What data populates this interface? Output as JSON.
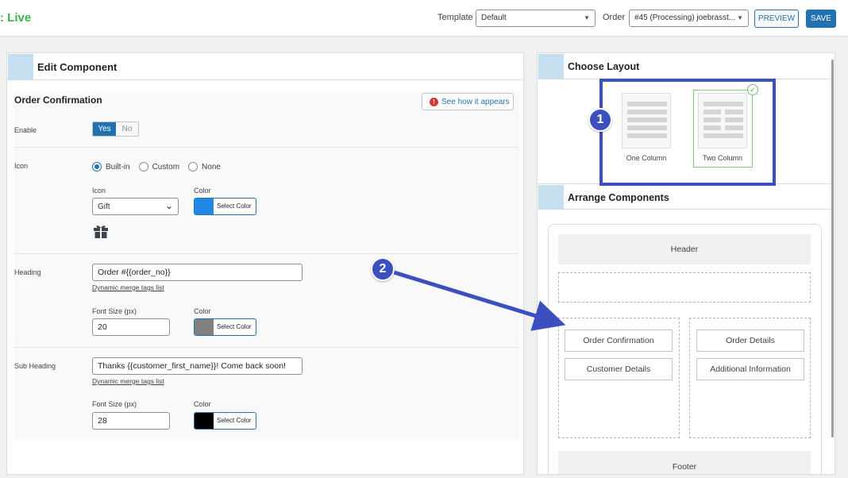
{
  "topbar": {
    "status": ": Live",
    "template_label": "Template",
    "template_value": "Default",
    "order_label": "Order",
    "order_value": "#45 (Processing) joebrasst...",
    "preview_label": "PREVIEW",
    "save_label": "SAVE"
  },
  "edit": {
    "panel_title": "Edit Component",
    "component_title": "Order Confirmation",
    "see_button": "See how it appears",
    "enable": {
      "label": "Enable",
      "yes": "Yes",
      "no": "No",
      "value": "Yes"
    },
    "icon": {
      "label": "Icon",
      "options": [
        "Built-in",
        "Custom",
        "None"
      ],
      "selected": "Built-in",
      "select_label": "Icon",
      "select_value": "Gift",
      "color_label": "Color",
      "color_value": "#1e88e5",
      "color_button": "Select Color",
      "preview_icon": "gift-icon"
    },
    "heading": {
      "label": "Heading",
      "value": "Order #{{order_no}}",
      "merge_link": "Dynamic merge tags list",
      "font_size_label": "Font Size (px)",
      "font_size_value": "20",
      "color_label": "Color",
      "color_value": "#808080",
      "color_button": "Select Color"
    },
    "subheading": {
      "label": "Sub Heading",
      "value": "Thanks {{customer_first_name}}! Come back soon!",
      "merge_link": "Dynamic merge tags list",
      "font_size_label": "Font Size (px)",
      "font_size_value": "28",
      "color_label": "Color",
      "color_value": "#000000",
      "color_button": "Select Color"
    }
  },
  "layout": {
    "title": "Choose Layout",
    "options": [
      "One Column",
      "Two Column"
    ],
    "selected": "Two Column"
  },
  "arrange": {
    "title": "Arrange Components",
    "header": "Header",
    "footer": "Footer",
    "left_column": [
      "Order Confirmation",
      "Customer Details"
    ],
    "right_column": [
      "Order Details",
      "Additional Information"
    ]
  },
  "annotations": {
    "one": "1",
    "two": "2",
    "color": "#3c4fbf"
  },
  "colors": {
    "accent": "#2271b1",
    "live": "#38b24a",
    "annotation": "#3c4fbf"
  }
}
